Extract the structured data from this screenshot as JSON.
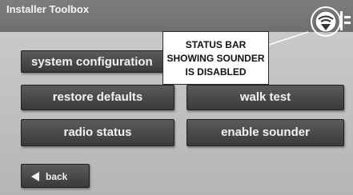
{
  "status_bar": {
    "title": "Installer Toolbox",
    "sounder_icon": "sounder-disabled-icon"
  },
  "buttons": {
    "system_configuration": "system configuration",
    "restore_defaults": "restore defaults",
    "walk_test": "walk test",
    "radio_status": "radio status",
    "enable_sounder": "enable sounder",
    "back": "back"
  },
  "callout": {
    "line1": "STATUS BAR",
    "line2": "SHOWING SOUNDER",
    "line3": "IS DISABLED"
  },
  "colors": {
    "status_bar": "#737373",
    "button": "#4a4a4a",
    "screen": "#bdbdbd"
  }
}
